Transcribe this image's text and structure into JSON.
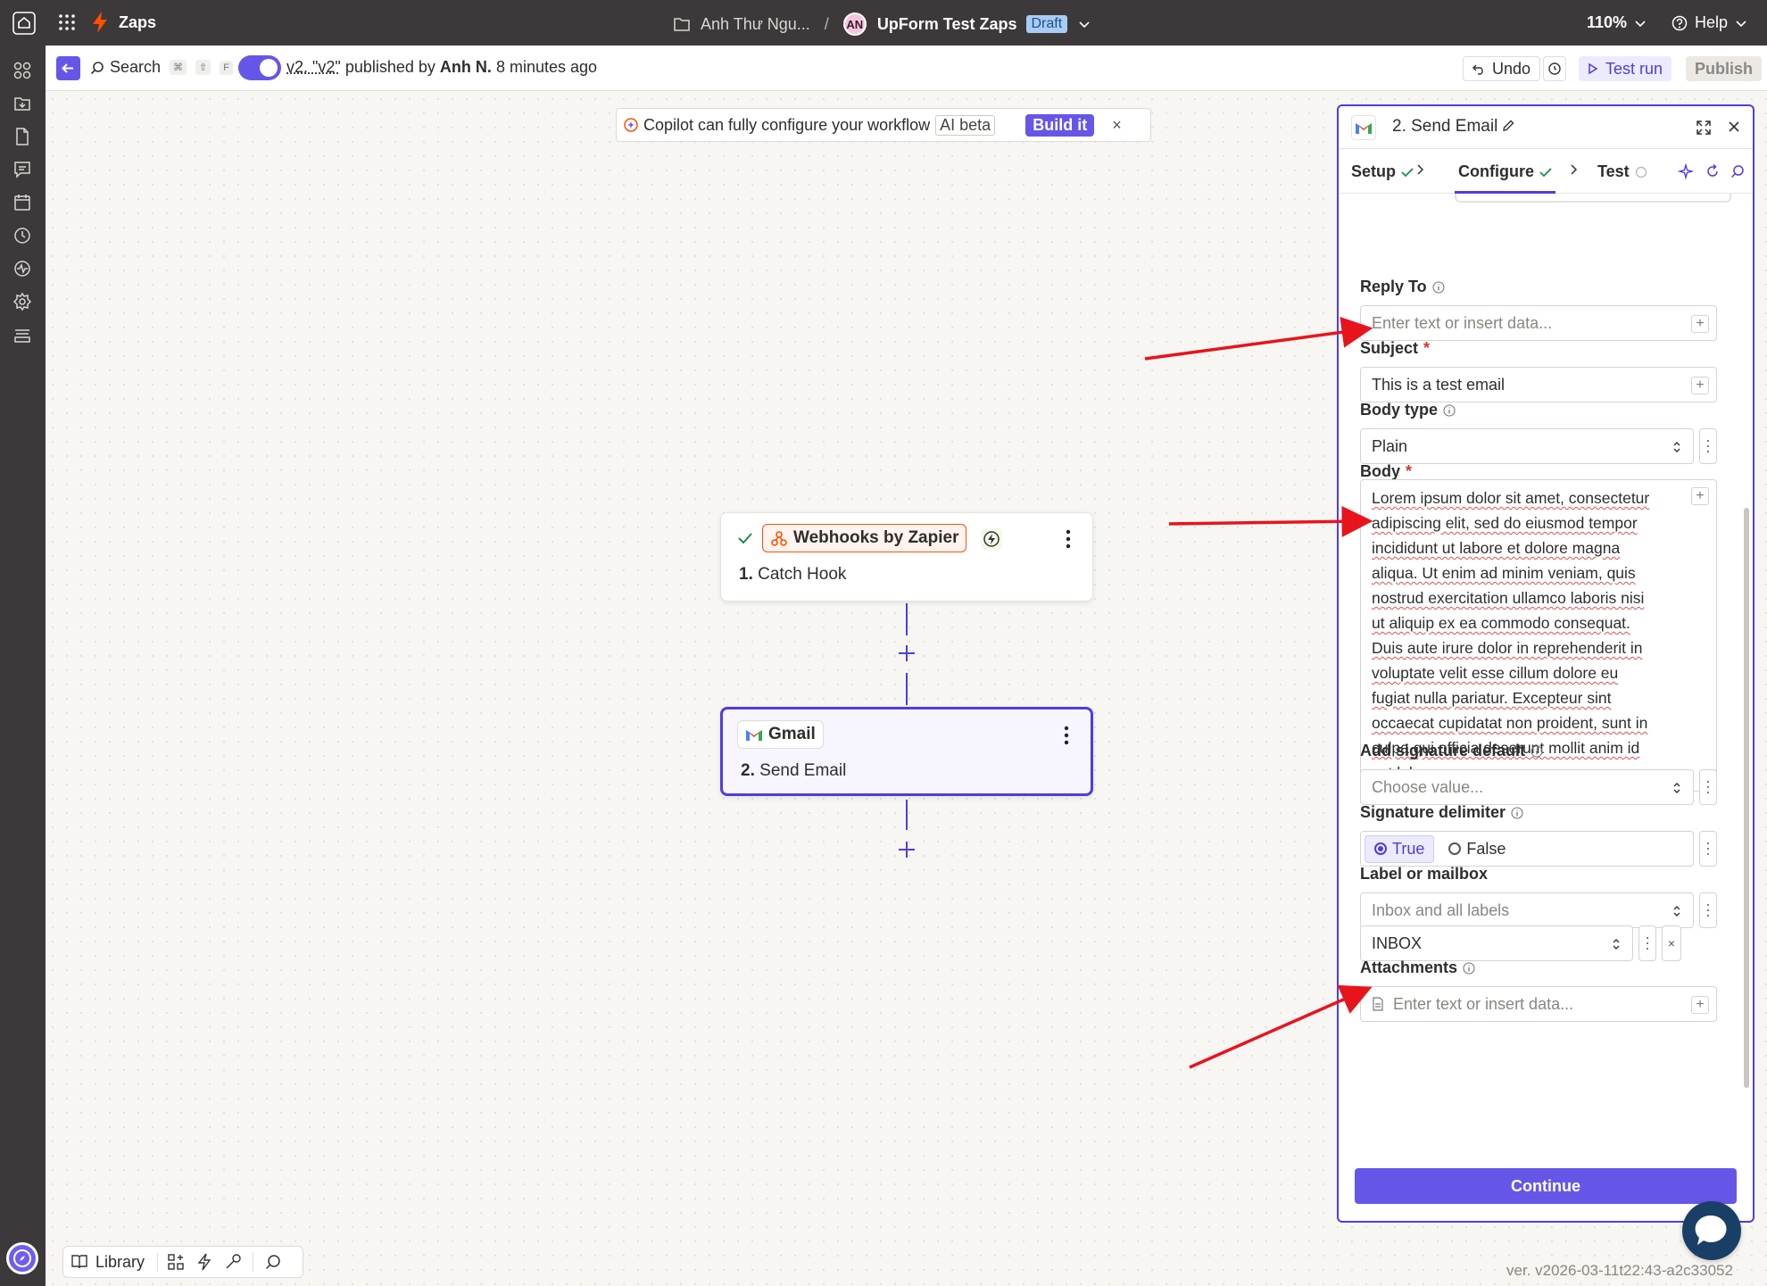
{
  "topbar": {
    "app_name": "Zaps",
    "folder": "Anh Thư Ngu...",
    "separator": "/",
    "avatar_initials": "AN",
    "zap_name": "UpForm Test Zaps",
    "status": "Draft",
    "zoom": "110%",
    "help": "Help"
  },
  "subbar": {
    "search": "Search",
    "shortcut_keys": [
      "⌘",
      "⇧",
      "F"
    ],
    "version_label": "v2. \"v2\"",
    "published_by": "published by",
    "author": "Anh N.",
    "time": "8 minutes ago",
    "undo": "Undo",
    "test_run": "Test run",
    "publish": "Publish"
  },
  "copilot": {
    "text": "Copilot can fully configure your workflow",
    "badge": "AI beta",
    "button": "Build it",
    "close": "×"
  },
  "nodes": [
    {
      "app": "Webhooks by Zapier",
      "step": "1.",
      "title": "Catch Hook"
    },
    {
      "app": "Gmail",
      "step": "2.",
      "title": "Send Email"
    }
  ],
  "panel": {
    "title": "2. Send Email",
    "tabs": [
      {
        "label": "Setup",
        "state": "done"
      },
      {
        "label": "Configure",
        "state": "done"
      },
      {
        "label": "Test",
        "state": "pending"
      }
    ],
    "fields": {
      "reply_to": {
        "label": "Reply To",
        "placeholder": "Enter text or insert data..."
      },
      "subject": {
        "label": "Subject",
        "required": "*",
        "value": "This is a test email"
      },
      "body_type": {
        "label": "Body type",
        "value": "Plain"
      },
      "body": {
        "label": "Body",
        "required": "*"
      },
      "signature": {
        "label": "Add signature default",
        "placeholder": "Choose value..."
      },
      "delimiter": {
        "label": "Signature delimiter",
        "true_label": "True",
        "false_label": "False"
      },
      "mailbox": {
        "label": "Label or mailbox",
        "placeholder": "Inbox and all labels",
        "value": "INBOX",
        "remove": "×"
      },
      "attachments": {
        "label": "Attachments",
        "placeholder": "Enter text or insert data..."
      }
    },
    "body_lines": [
      "Lorem ipsum dolor sit amet, consectetur",
      "adipiscing elit, sed do eiusmod tempor",
      "incididunt ut labore et dolore magna",
      "aliqua. Ut enim ad minim veniam, quis",
      "nostrud exercitation ullamco laboris nisi",
      "ut aliquip ex ea commodo consequat.",
      "Duis aute irure dolor in reprehenderit in",
      "voluptate velit esse cillum dolore eu",
      "fugiat nulla pariatur. Excepteur sint",
      "occaecat cupidatat non proident, sunt in",
      "culpa qui officia deserunt mollit anim id",
      "est laborum."
    ],
    "continue": "Continue"
  },
  "bottom_toolbar": {
    "library": "Library"
  },
  "version_info": "ver. v2026-03-11t22:43-a2c33052",
  "colors": {
    "accent": "#6656e8",
    "topbar": "#3d3839",
    "annotation": "#e8141c",
    "zapier_orange": "#ff4f00"
  }
}
